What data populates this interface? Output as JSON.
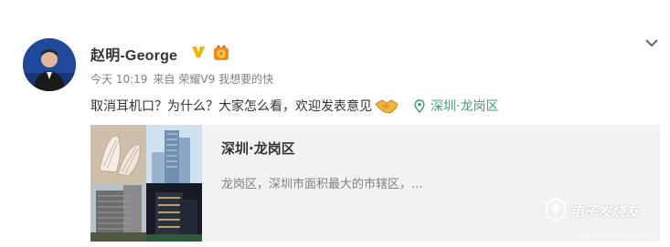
{
  "post": {
    "author_name": "赵明-George",
    "verified_badge": "v-verified-icon",
    "medal_badge": "medal-icon",
    "time": "今天 10:19",
    "source_prefix": "来自",
    "source": "荣耀V9 我想要的快",
    "text": "取消耳机口？为什么？大家怎么看，欢迎发表意见",
    "emoji": "handshake-icon",
    "location": "深圳·龙岗区"
  },
  "card": {
    "title": "深圳·龙岗区",
    "description": "龙岗区，深圳市面积最大的市辖区，..."
  },
  "watermark": {
    "text": "电子发烧友",
    "url": "www.elecfans.com"
  },
  "colors": {
    "location_green": "#3ba36d",
    "verified_gold": "#f5b400",
    "card_bg": "#f2f2f5"
  }
}
